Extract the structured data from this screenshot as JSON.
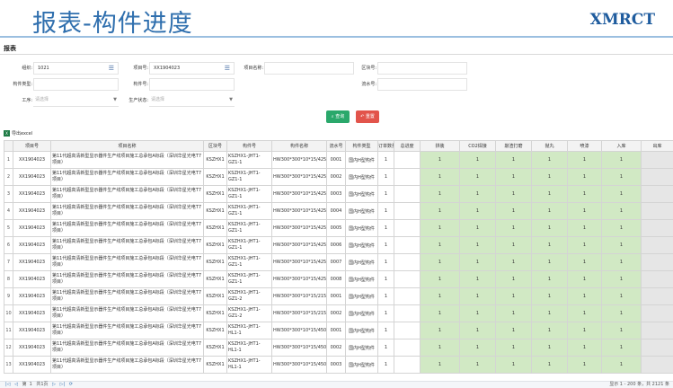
{
  "header": {
    "title": "报表-构件进度",
    "logo": "XMRCT"
  },
  "section_title": "报表",
  "form": {
    "org_label": "组织:",
    "org_value": "1021",
    "project_no_label": "项目号:",
    "project_no_value": "XX1904023",
    "project_name_label": "项目名称:",
    "block_label": "区块号:",
    "component_type_label": "构件类型:",
    "component_no_label": "构件号:",
    "serial_label": "流水号:",
    "process_label": "工序:",
    "process_placeholder": "请选择",
    "status_label": "生产状态:",
    "status_placeholder": "请选择",
    "query_button": "查询",
    "reset_button": "重置"
  },
  "export_label": "导出excel",
  "table": {
    "columns": [
      "",
      "项目号",
      "项目名称",
      "区块号",
      "构件号",
      "构件名称",
      "流水号",
      "构件类型",
      "订单数量",
      "总进度",
      "拼装",
      "CO2焊接",
      "敲渣打磨",
      "抛丸",
      "喷漆",
      "入库",
      "出库"
    ],
    "rows": [
      {
        "idx": "1",
        "project": "XX1904023",
        "name": "第11代超高清新型显示器件生产线项目施工总承包A标段（深圳华星光电T7项目）",
        "block": "KSZHX1",
        "comp": "KSZHX1-JHT1-GZ1-1",
        "cname": "HW300*300*10*15/4250.0",
        "serial": "0001",
        "type": "国内H型构件",
        "qty": "1",
        "p1": "1",
        "p2": "1",
        "p3": "1",
        "p4": "1",
        "p5": "1",
        "p6": "1"
      },
      {
        "idx": "2",
        "project": "XX1904023",
        "name": "第11代超高清新型显示器件生产线项目施工总承包A标段（深圳华星光电T7项目）",
        "block": "KSZHX1",
        "comp": "KSZHX1-JHT1-GZ1-1",
        "cname": "HW300*300*10*15/4250.0",
        "serial": "0002",
        "type": "国内H型构件",
        "qty": "1",
        "p1": "1",
        "p2": "1",
        "p3": "1",
        "p4": "1",
        "p5": "1",
        "p6": "1"
      },
      {
        "idx": "3",
        "project": "XX1904023",
        "name": "第11代超高清新型显示器件生产线项目施工总承包A标段（深圳华星光电T7项目）",
        "block": "KSZHX1",
        "comp": "KSZHX1-JHT1-GZ1-1",
        "cname": "HW300*300*10*15/4250.0",
        "serial": "0003",
        "type": "国内H型构件",
        "qty": "1",
        "p1": "1",
        "p2": "1",
        "p3": "1",
        "p4": "1",
        "p5": "1",
        "p6": "1"
      },
      {
        "idx": "4",
        "project": "XX1904023",
        "name": "第11代超高清新型显示器件生产线项目施工总承包A标段（深圳华星光电T7项目）",
        "block": "KSZHX1",
        "comp": "KSZHX1-JHT1-GZ1-1",
        "cname": "HW300*300*10*15/4250.0",
        "serial": "0004",
        "type": "国内H型构件",
        "qty": "1",
        "p1": "1",
        "p2": "1",
        "p3": "1",
        "p4": "1",
        "p5": "1",
        "p6": "1"
      },
      {
        "idx": "5",
        "project": "XX1904023",
        "name": "第11代超高清新型显示器件生产线项目施工总承包A标段（深圳华星光电T7项目）",
        "block": "KSZHX1",
        "comp": "KSZHX1-JHT1-GZ1-1",
        "cname": "HW300*300*10*15/4250.0",
        "serial": "0005",
        "type": "国内H型构件",
        "qty": "1",
        "p1": "1",
        "p2": "1",
        "p3": "1",
        "p4": "1",
        "p5": "1",
        "p6": "1"
      },
      {
        "idx": "6",
        "project": "XX1904023",
        "name": "第11代超高清新型显示器件生产线项目施工总承包A标段（深圳华星光电T7项目）",
        "block": "KSZHX1",
        "comp": "KSZHX1-JHT1-GZ1-1",
        "cname": "HW300*300*10*15/4250.0",
        "serial": "0006",
        "type": "国内H型构件",
        "qty": "1",
        "p1": "1",
        "p2": "1",
        "p3": "1",
        "p4": "1",
        "p5": "1",
        "p6": "1"
      },
      {
        "idx": "7",
        "project": "XX1904023",
        "name": "第11代超高清新型显示器件生产线项目施工总承包A标段（深圳华星光电T7项目）",
        "block": "KSZHX1",
        "comp": "KSZHX1-JHT1-GZ1-1",
        "cname": "HW300*300*10*15/4250.0",
        "serial": "0007",
        "type": "国内H型构件",
        "qty": "1",
        "p1": "1",
        "p2": "1",
        "p3": "1",
        "p4": "1",
        "p5": "1",
        "p6": "1"
      },
      {
        "idx": "8",
        "project": "XX1904023",
        "name": "第11代超高清新型显示器件生产线项目施工总承包A标段（深圳华星光电T7项目）",
        "block": "KSZHX1",
        "comp": "KSZHX1-JHT1-GZ1-1",
        "cname": "HW300*300*10*15/4250.0",
        "serial": "0008",
        "type": "国内H型构件",
        "qty": "1",
        "p1": "1",
        "p2": "1",
        "p3": "1",
        "p4": "1",
        "p5": "1",
        "p6": "1"
      },
      {
        "idx": "9",
        "project": "XX1904023",
        "name": "第11代超高清新型显示器件生产线项目施工总承包A标段（深圳华星光电T7项目）",
        "block": "KSZHX1",
        "comp": "KSZHX1-JHT1-GZ1-2",
        "cname": "HW300*300*10*15/2150.0",
        "serial": "0001",
        "type": "国内H型构件",
        "qty": "1",
        "p1": "1",
        "p2": "1",
        "p3": "1",
        "p4": "1",
        "p5": "1",
        "p6": "1"
      },
      {
        "idx": "10",
        "project": "XX1904023",
        "name": "第11代超高清新型显示器件生产线项目施工总承包A标段（深圳华星光电T7项目）",
        "block": "KSZHX1",
        "comp": "KSZHX1-JHT1-GZ1-2",
        "cname": "HW300*300*10*15/2150.0",
        "serial": "0002",
        "type": "国内H型构件",
        "qty": "1",
        "p1": "1",
        "p2": "1",
        "p3": "1",
        "p4": "1",
        "p5": "1",
        "p6": "1"
      },
      {
        "idx": "11",
        "project": "XX1904023",
        "name": "第11代超高清新型显示器件生产线项目施工总承包A标段（深圳华星光电T7项目）",
        "block": "KSZHX1",
        "comp": "KSZHX1-JHT1-HL1-1",
        "cname": "HW300*300*10*15/4500.0",
        "serial": "0001",
        "type": "国内H型构件",
        "qty": "1",
        "p1": "1",
        "p2": "1",
        "p3": "1",
        "p4": "1",
        "p5": "1",
        "p6": "1"
      },
      {
        "idx": "12",
        "project": "XX1904023",
        "name": "第11代超高清新型显示器件生产线项目施工总承包A标段（深圳华星光电T7项目）",
        "block": "KSZHX1",
        "comp": "KSZHX1-JHT1-HL1-1",
        "cname": "HW300*300*10*15/4500.0",
        "serial": "0002",
        "type": "国内H型构件",
        "qty": "1",
        "p1": "1",
        "p2": "1",
        "p3": "1",
        "p4": "1",
        "p5": "1",
        "p6": "1"
      },
      {
        "idx": "13",
        "project": "XX1904023",
        "name": "第11代超高清新型显示器件生产线项目施工总承包A标段（深圳华星光电T7项目）",
        "block": "KSZHX1",
        "comp": "KSZHX1-JHT1-HL1-1",
        "cname": "HW300*300*10*15/4500.0",
        "serial": "0003",
        "type": "国内H型构件",
        "qty": "1",
        "p1": "1",
        "p2": "1",
        "p3": "1",
        "p4": "1",
        "p5": "1",
        "p6": "1"
      }
    ]
  },
  "footer": {
    "first": "|◁",
    "prev": "◁",
    "page_prefix": "第",
    "page": "1",
    "page_total": "共1页",
    "next": "▷",
    "last": "▷|",
    "refresh": "⟳",
    "summary": "显示 1 - 200 条，共 2121 条"
  }
}
